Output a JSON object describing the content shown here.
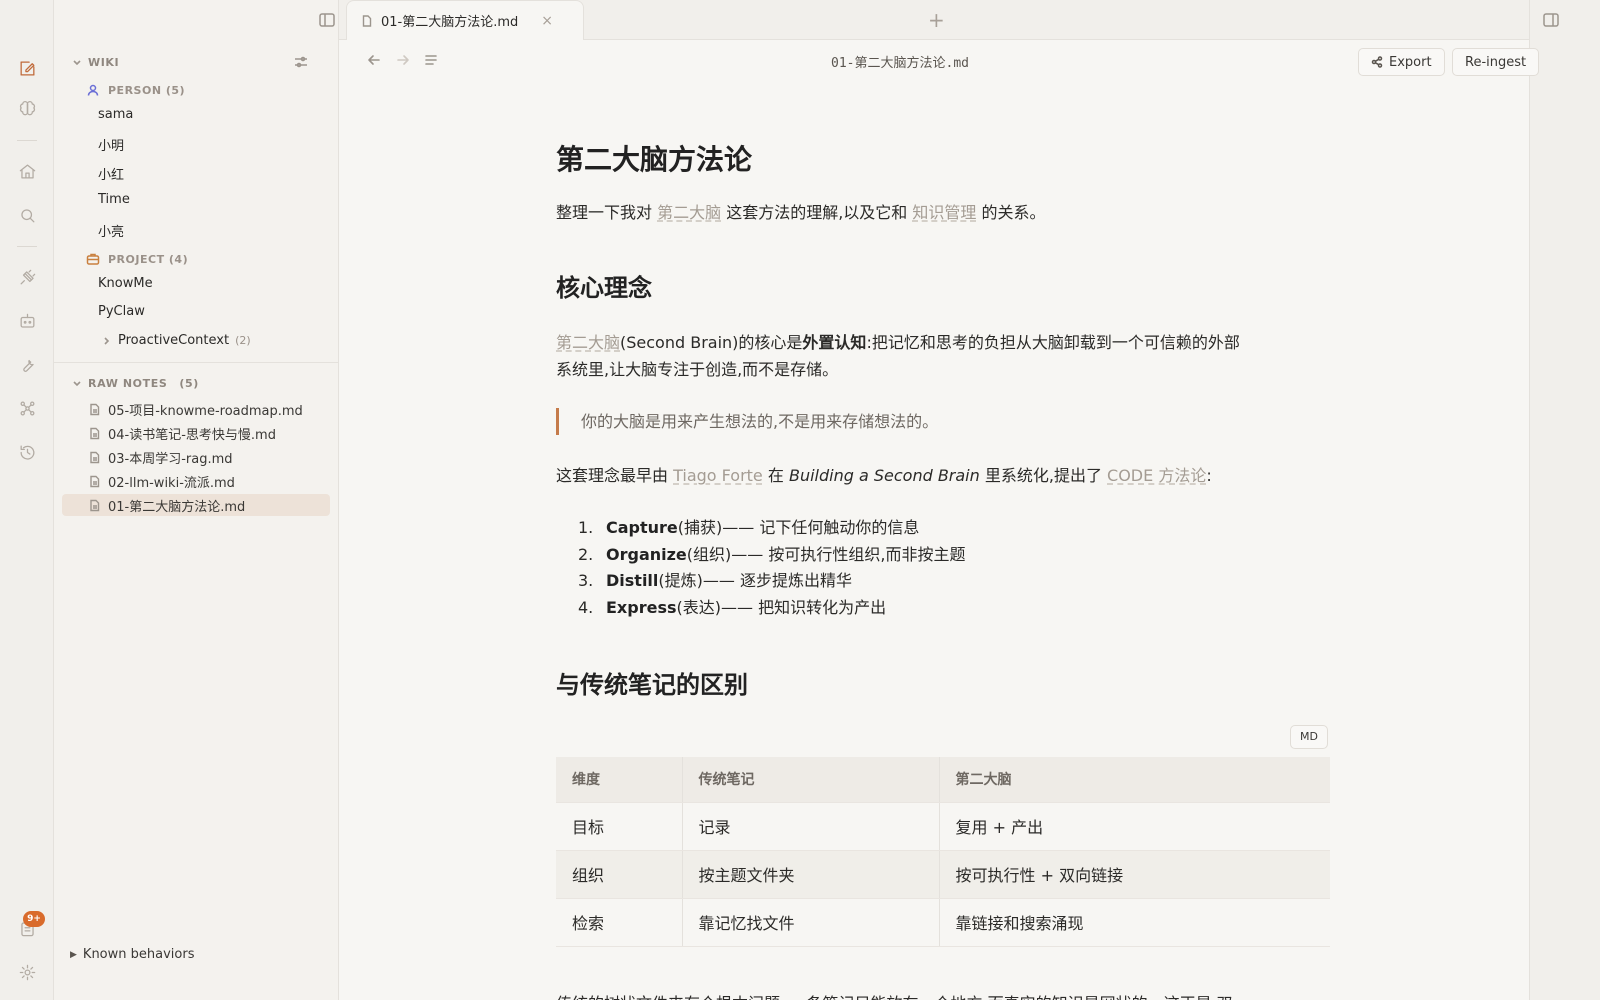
{
  "activity_bar": {
    "badge_count": "9+",
    "icons": [
      "edit-icon",
      "brain-icon",
      "home-icon",
      "search-icon",
      "plug-icon",
      "bot-icon",
      "wrench-icon",
      "graph-icon",
      "history-icon",
      "clipboard-icon",
      "settings-icon"
    ]
  },
  "sidebar": {
    "wiki_header": "WIKI",
    "person_group": "PERSON (5)",
    "persons": [
      "sama",
      "小明",
      "小红",
      "Time",
      "小亮"
    ],
    "project_group": "PROJECT (4)",
    "projects": [
      "KnowMe",
      "PyClaw"
    ],
    "folder": {
      "label": "ProactiveContext",
      "count": "(2)"
    },
    "raw_notes_header": "RAW NOTES",
    "raw_notes_count": "(5)",
    "raw_notes": [
      "05-项目-knowme-roadmap.md",
      "04-读书笔记-思考快与慢.md",
      "03-本周学习-rag.md",
      "02-llm-wiki-流派.md",
      "01-第二大脑方法论.md"
    ],
    "known_behaviors": "Known behaviors"
  },
  "tabs": {
    "active_tab": "01-第二大脑方法论.md",
    "close_glyph": "×",
    "new_tab_glyph": "+"
  },
  "toolbar": {
    "doc_path": "01-第二大脑方法论.md",
    "export_label": "Export",
    "reingest_label": "Re-ingest"
  },
  "doc": {
    "title": "第二大脑方法论",
    "intro": {
      "pre": "整理一下我对 ",
      "link1": "第二大脑",
      "mid": " 这套方法的理解,以及它和 ",
      "link2": "知识管理",
      "post": " 的关系。"
    },
    "h2_core": "核心理念",
    "core_para": {
      "link": "第二大脑",
      "pre": "(Second Brain)的核心是",
      "bold": "外置认知",
      "post": ":把记忆和思考的负担从大脑卸载到一个可信赖的外部",
      "line2": "系统里,让大脑专注于创造,而不是存储。"
    },
    "quote": "你的大脑是用来产生想法的,不是用来存储想法的。",
    "origin_para": {
      "pre": "这套理念最早由 ",
      "link1": "Tiago Forte",
      "mid1": " 在 ",
      "book": "Building a Second Brain",
      "mid2": " 里系统化,提出了 ",
      "link2": "CODE 方法论",
      "post": ":"
    },
    "code_list": [
      {
        "num": "1.",
        "term": "Capture",
        "desc": "(捕获)—— 记下任何触动你的信息"
      },
      {
        "num": "2.",
        "term": "Organize",
        "desc": "(组织)—— 按可执行性组织,而非按主题"
      },
      {
        "num": "3.",
        "term": "Distill",
        "desc": "(提炼)—— 逐步提炼出精华"
      },
      {
        "num": "4.",
        "term": "Express",
        "desc": "(表达)—— 把知识转化为产出"
      }
    ],
    "h2_diff": "与传统笔记的区别",
    "md_badge": "MD",
    "table": {
      "headers": [
        "维度",
        "传统笔记",
        "第二大脑"
      ],
      "rows": [
        [
          "目标",
          "记录",
          "复用 + 产出"
        ],
        [
          "组织",
          "按主题文件夹",
          "按可执行性 + 双向链接"
        ],
        [
          "检索",
          "靠记忆找文件",
          "靠链接和搜索涌现"
        ]
      ]
    },
    "cut_line": "传统的树状文件夹有个根本问题: 一条笔记只能放在一个地方,而真实的知识是网状的。这正是 双"
  }
}
